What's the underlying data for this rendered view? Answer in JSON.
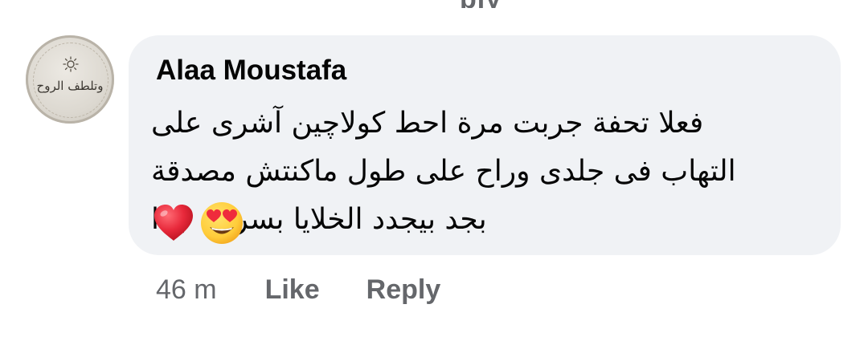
{
  "previous_comment": {
    "reply_fragment": "ply"
  },
  "comment": {
    "author": "Alaa Moustafa",
    "avatar_text": "وتلطف الروح",
    "lines": [
      "فعلا تحفة جربت مرة احط كولاچين آشرى على",
      "التهاب فى جلدى وراح على طول ماكنتش مصدقة",
      "بجد بيجدد الخلايا بسرعة جدا"
    ],
    "emojis": [
      "heart-eyes-face-icon",
      "red-heart-icon"
    ],
    "timestamp": "46 m",
    "like_label": "Like",
    "reply_label": "Reply"
  },
  "colors": {
    "bubble_bg": "#f0f2f5",
    "text_primary": "#050505",
    "text_secondary": "#65676b",
    "heart": "#e8293b",
    "emoji_face": "#ffcc3a"
  }
}
